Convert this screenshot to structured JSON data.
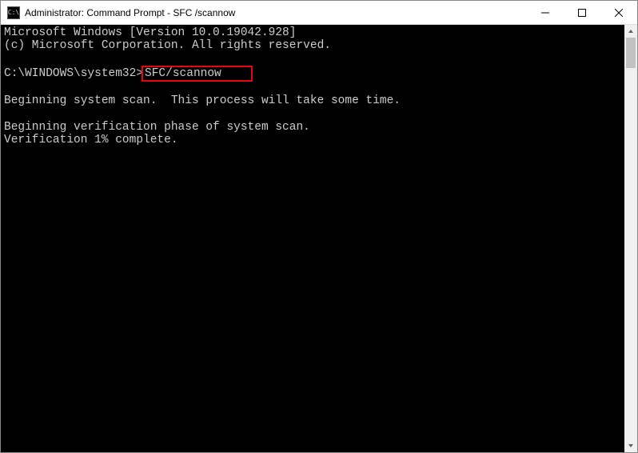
{
  "titlebar": {
    "icon_text": "C:\\",
    "title": "Administrator: Command Prompt - SFC /scannow"
  },
  "terminal": {
    "line1": "Microsoft Windows [Version 10.0.19042.928]",
    "line2": "(c) Microsoft Corporation. All rights reserved.",
    "prompt_path": "C:\\WINDOWS\\system32>",
    "command": "SFC/scannow",
    "line_scan": "Beginning system scan.  This process will take some time.",
    "line_verif1": "Beginning verification phase of system scan.",
    "line_verif2": "Verification 1% complete."
  }
}
